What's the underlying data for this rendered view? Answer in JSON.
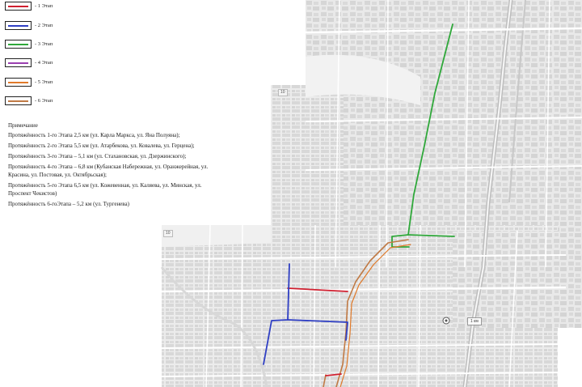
{
  "legend": [
    {
      "label": "- 1 Этап",
      "color": "#d02030"
    },
    {
      "label": "- 2 Этап",
      "color": "#2f3fc4"
    },
    {
      "label": "- 3 Этап",
      "color": "#2fa83a"
    },
    {
      "label": "- 4 Этап",
      "color": "#9a3fb0"
    },
    {
      "label": "- 5 Этап",
      "color": "#e07a2a"
    },
    {
      "label": "- 6 Этап",
      "color": "#c07a45"
    }
  ],
  "notes": {
    "title": "Примечание",
    "lines": [
      "Протяжённость 1-го Этапа 2,5 км (ул. Карла Маркса, ул. Яна Полуяна);",
      "Протяжённость 2-го Этапа 5,5 км (ул. Атарбекова, ул. Ковалева, ул. Герцена);",
      "Протяжённость 3-го Этапа – 5,1 км (ул. Стахановская, ул. Дзержинского);",
      "Протяжённость 4-го Этапа – 6,8 км (Кубанская Набережная, ул. Оранжерейная, ул.",
      "Красина, ул. Постовая, ул. Октябрьская);",
      "Протяжённость 5-го Этапа 6,5 км (ул. Кожевенная, ул. Каляева, ул. Минская, ул.",
      "Проспект Чекистов)",
      "Протяжённость 6-гоЭтапа – 5,2 км (ул. Тургенева)"
    ]
  },
  "map": {
    "badges": [
      "10",
      "10"
    ],
    "scale_text": "1 км"
  }
}
